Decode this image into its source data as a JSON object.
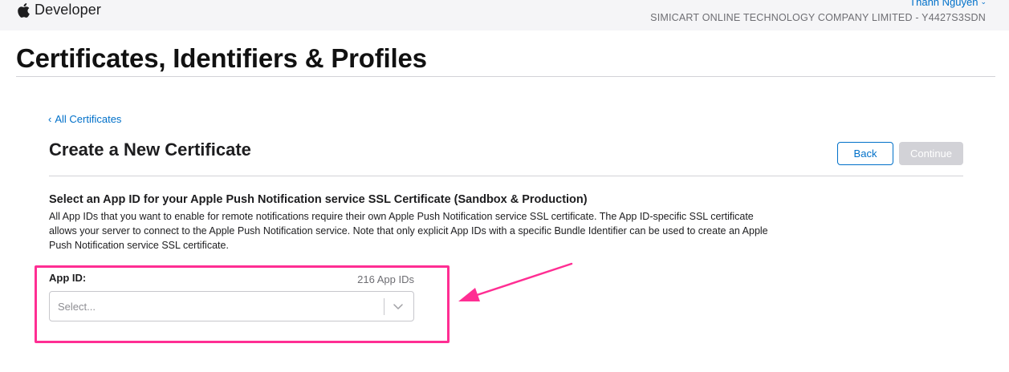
{
  "header": {
    "brand": "Developer",
    "user_name": "Thanh Nguyen",
    "team": "SIMICART ONLINE TECHNOLOGY COMPANY LIMITED - Y4427S3SDN"
  },
  "page": {
    "title": "Certificates, Identifiers & Profiles"
  },
  "content": {
    "back_link": "All Certificates",
    "section_title": "Create a New Certificate",
    "buttons": {
      "back": "Back",
      "continue": "Continue"
    },
    "description_heading": "Select an App ID for your Apple Push Notification service SSL Certificate (Sandbox & Production)",
    "description_text": "All App IDs that you want to enable for remote notifications require their own Apple Push Notification service SSL certificate. The App ID-specific SSL certificate allows your server to connect to the Apple Push Notification service. Note that only explicit App IDs with a specific Bundle Identifier can be used to create an Apple Push Notification service SSL certificate.",
    "app_id": {
      "label": "App ID:",
      "count": "216 App IDs",
      "placeholder": "Select..."
    }
  },
  "annotation": {
    "highlight_color": "#ff2e93"
  },
  "colors": {
    "link": "#0070c9",
    "disabled_button": "#d2d2d7",
    "header_bg": "#f5f5f7"
  },
  "icons": [
    "apple-logo-icon",
    "chevron-down-icon",
    "chevron-left-icon",
    "annotation-arrow"
  ]
}
